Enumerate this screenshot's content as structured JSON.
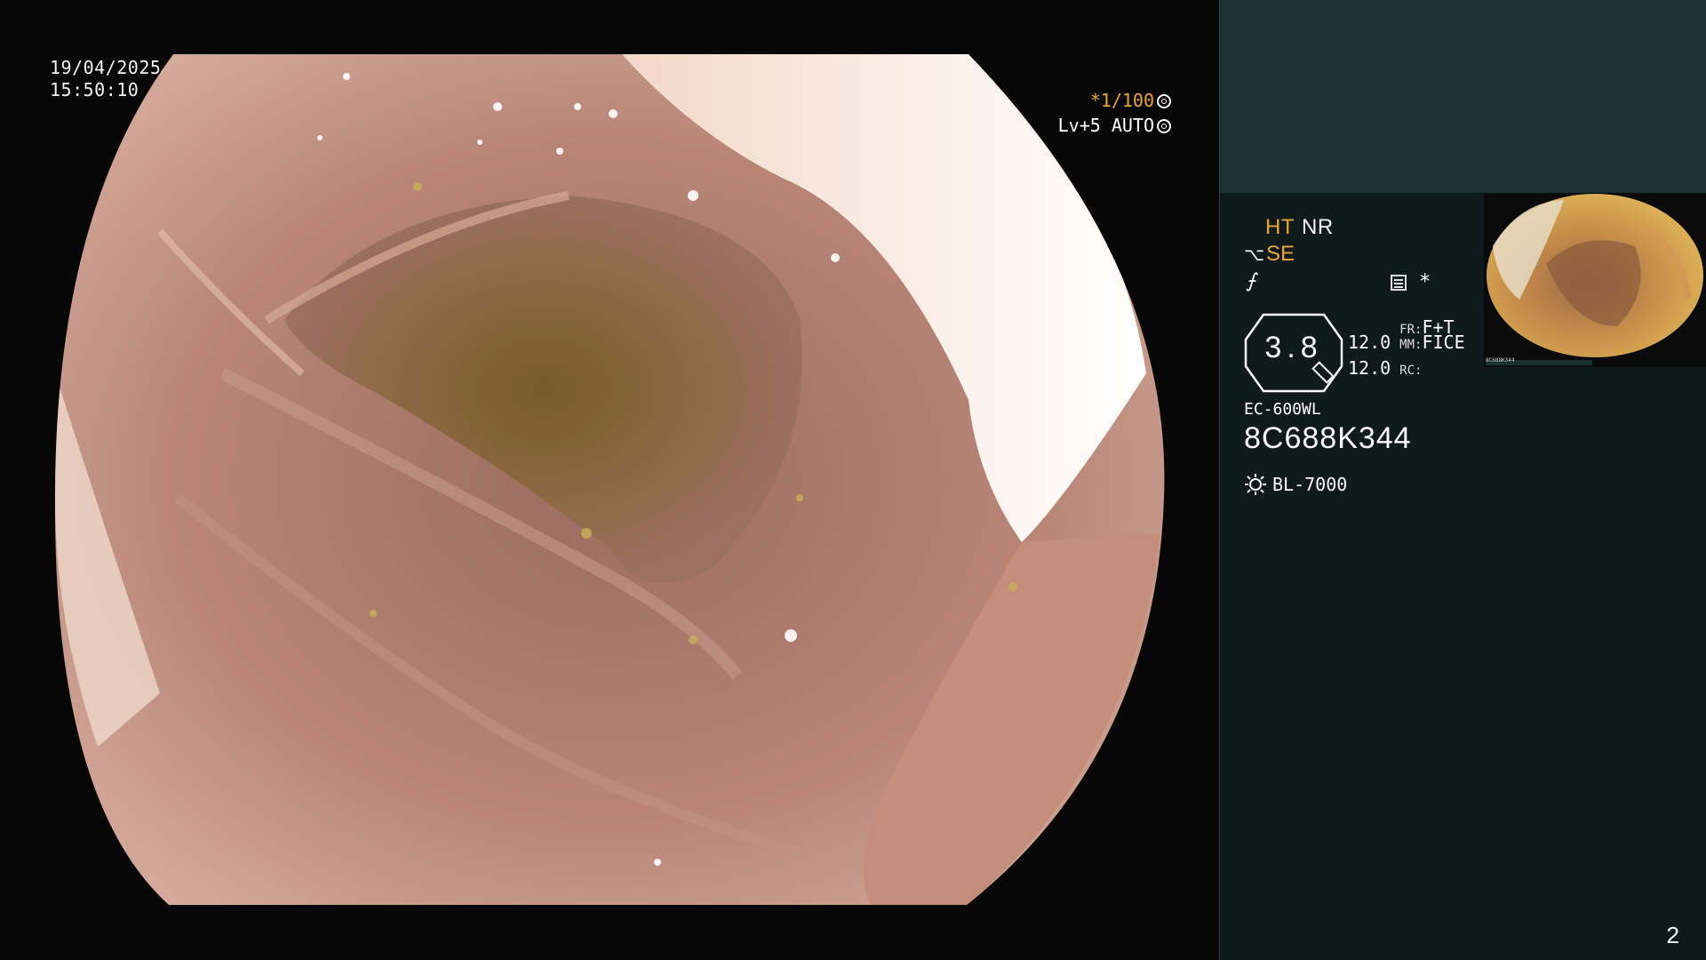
{
  "timestamp": {
    "date": "19/04/2025",
    "time": "15:50:10"
  },
  "shutter": {
    "speed": "*1/100",
    "level": "Lv+5",
    "mode": "AUTO"
  },
  "panel": {
    "mode_ht": "HT",
    "mode_nr": "NR",
    "se_label": "SE",
    "f_icon": "⨍",
    "asterisk": "*",
    "zoom": "3.8",
    "readouts": {
      "value1": "12.0",
      "value2": "12.0",
      "fr_label": "FR:",
      "fr_value": "F+T",
      "mm_label": "MM:",
      "mm_value": "FICE",
      "rc_label": "RC:"
    },
    "scope_model": "EC-600WL",
    "scope_serial": "8C688K344",
    "light_source": "BL-7000",
    "thumbnail_label": "8C688K344"
  },
  "page_number": "2",
  "colors": {
    "accent_orange": "#e8a53a",
    "panel_top": "#193230",
    "panel_bottom": "#0e1b1a"
  },
  "icons": [
    "gear-icon",
    "scope-icon",
    "menu-icon",
    "sun-icon",
    "magnify-icon"
  ]
}
